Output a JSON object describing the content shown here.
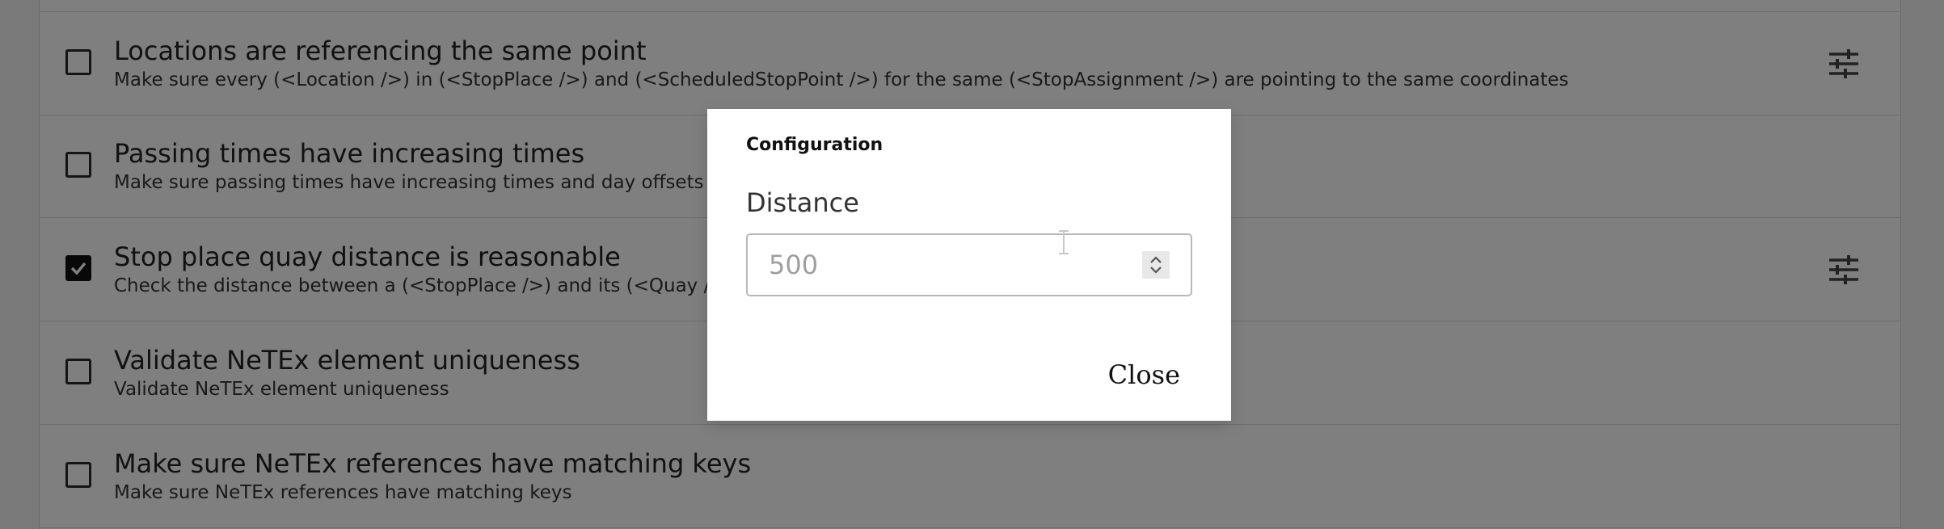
{
  "rules": [
    {
      "title": "Locations are referencing the same point",
      "description": "Make sure every (<Location />) in (<StopPlace />) and (<ScheduledStopPoint />) for the same (<StopAssignment />) are pointing to the same coordinates",
      "checked": false,
      "configurable": true
    },
    {
      "title": "Passing times have increasing times",
      "description": "Make sure passing times have increasing times and day offsets",
      "checked": false,
      "configurable": false
    },
    {
      "title": "Stop place quay distance is reasonable",
      "description": "Check the distance between a (<StopPlace />) and its (<Quay />",
      "checked": true,
      "configurable": true
    },
    {
      "title": "Validate NeTEx element uniqueness",
      "description": "Validate NeTEx element uniqueness",
      "checked": false,
      "configurable": false
    },
    {
      "title": "Make sure NeTEx references have matching keys",
      "description": "Make sure NeTEx references have matching keys",
      "checked": false,
      "configurable": false
    }
  ],
  "icons": {
    "configure": "tune-icon",
    "checked": "checkmark-icon",
    "stepper": "chevron-up-down-icon",
    "cursor": "text-cursor-icon"
  },
  "dialog": {
    "title": "Configuration",
    "field_label": "Distance",
    "field_placeholder": "500",
    "field_value": "",
    "close_label": "Close"
  },
  "colors": {
    "overlay": "#000000",
    "checkbox_checked": "#111111",
    "text": "#222222"
  }
}
